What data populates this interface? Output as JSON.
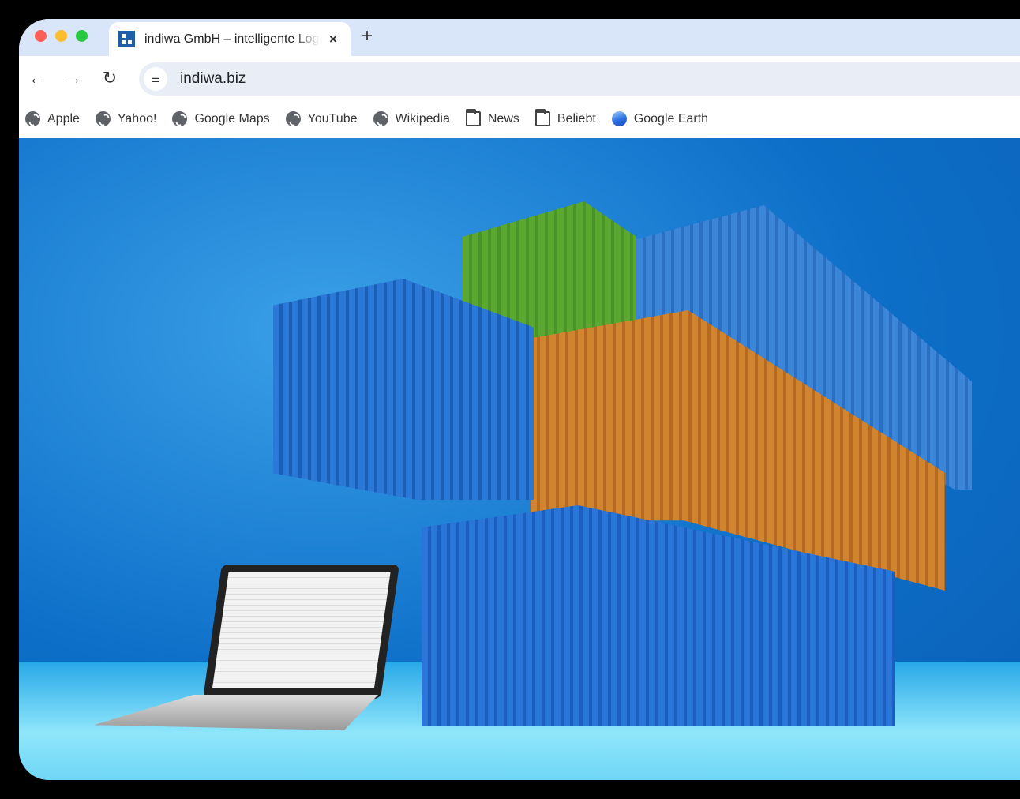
{
  "browser": {
    "tab": {
      "title": "indiwa GmbH – intelligente Logistik",
      "favicon": "indiwa-logo-icon",
      "close": "×"
    },
    "new_tab": "+",
    "nav": {
      "back": "←",
      "forward": "→",
      "reload": "↻"
    },
    "address": {
      "url": "indiwa.biz",
      "site_info_icon": "tune-icon"
    },
    "bookmarks": [
      {
        "label": "Apple",
        "icon": "globe"
      },
      {
        "label": "Yahoo!",
        "icon": "globe"
      },
      {
        "label": "Google Maps",
        "icon": "globe"
      },
      {
        "label": "YouTube",
        "icon": "globe"
      },
      {
        "label": "Wikipedia",
        "icon": "globe"
      },
      {
        "label": "News",
        "icon": "folder"
      },
      {
        "label": "Beliebt",
        "icon": "folder"
      },
      {
        "label": "Google Earth",
        "icon": "earth"
      }
    ]
  },
  "hero": {
    "image": "stacked shipping containers with laptop",
    "colors": {
      "background": "#0d6fc8",
      "green": "#5aa832",
      "orange": "#c87a2a",
      "blue": "#1f66c8"
    }
  }
}
